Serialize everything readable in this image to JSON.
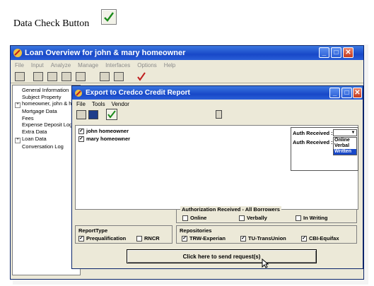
{
  "doc": {
    "title": "Data Check Button"
  },
  "app": {
    "title": "Loan Overview for john & mary homeowner",
    "menu": [
      "File",
      "Input",
      "Analyze",
      "Manage",
      "Interfaces",
      "Options",
      "Help"
    ]
  },
  "tree": [
    {
      "label": "General Information",
      "expand": false
    },
    {
      "label": "Subject Property",
      "expand": false
    },
    {
      "label": "homeowner, john & ho",
      "expand": true
    },
    {
      "label": "Mortgage Data",
      "expand": false
    },
    {
      "label": "Fees",
      "expand": false
    },
    {
      "label": "Expense Deposit Log",
      "expand": false
    },
    {
      "label": "Extra Data",
      "expand": false
    },
    {
      "label": "Loan Data",
      "expand": true
    },
    {
      "label": "Conversation Log",
      "expand": false
    }
  ],
  "dialog": {
    "title": "Export to Credco Credit Report",
    "menu": [
      "File",
      "Tools",
      "Vendor"
    ],
    "borrowers": [
      {
        "name": "john homeowner",
        "checked": true
      },
      {
        "name": "mary homeowner",
        "checked": true
      }
    ],
    "auth_label_1": "Auth Received :",
    "auth_label_2": "Auth Received :",
    "auth_options": [
      "Online",
      "Verbal",
      "Written"
    ],
    "auth_selected": "Written",
    "auth_all_title": "Authorization Received - All Borrowers",
    "auth_all_options": [
      {
        "label": "Online",
        "checked": false
      },
      {
        "label": "Verbally",
        "checked": false
      },
      {
        "label": "In Writing",
        "checked": false
      }
    ],
    "report_type_title": "ReportType",
    "report_types": [
      {
        "label": "Prequalification",
        "checked": true
      },
      {
        "label": "RNCR",
        "checked": false
      }
    ],
    "repositories_title": "Repositories",
    "repositories": [
      {
        "label": "TRW-Experian",
        "checked": true
      },
      {
        "label": "TU-TransUnion",
        "checked": true
      },
      {
        "label": "CBI-Equifax",
        "checked": true
      }
    ],
    "send_label": "Click here to send request(s)"
  },
  "colors": {
    "titlebar": "#1848c8",
    "close": "#c43b1f",
    "check": "#1a8a1a"
  }
}
